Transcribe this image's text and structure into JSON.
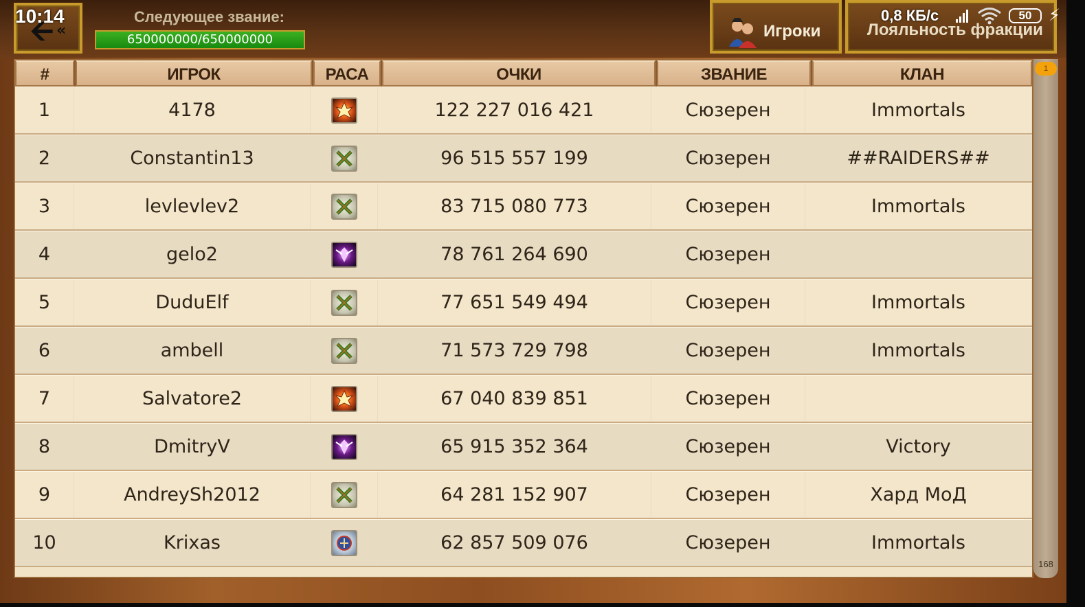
{
  "status_bar": {
    "time": "10:14",
    "network_speed": "0,8 КБ/с",
    "battery": "50"
  },
  "header": {
    "back_icon": "back-arrow-icon",
    "next_rank_label": "Следующее звание:",
    "progress_text": "650000000/650000000",
    "progress_fraction": 1.0,
    "tabs": [
      {
        "label": "Игроки",
        "icon": "players-icon"
      },
      {
        "label": "Лояльность фракции"
      }
    ]
  },
  "table": {
    "columns": [
      "#",
      "ИГРОК",
      "РАСА",
      "ОЧКИ",
      "ЗВАНИЕ",
      "КЛАН"
    ],
    "rows": [
      {
        "rank": "1",
        "player": "4178",
        "race": "fire",
        "points": "122 227 016 421",
        "title": "Сюзерен",
        "clan": "Immortals"
      },
      {
        "rank": "2",
        "player": "Constantin13",
        "race": "green",
        "points": "96 515 557 199",
        "title": "Сюзерен",
        "clan": "##RAIDERS##"
      },
      {
        "rank": "3",
        "player": "levlevlev2",
        "race": "green",
        "points": "83 715 080 773",
        "title": "Сюзерен",
        "clan": "Immortals"
      },
      {
        "rank": "4",
        "player": "gelo2",
        "race": "purple",
        "points": "78 761 264 690",
        "title": "Сюзерен",
        "clan": ""
      },
      {
        "rank": "5",
        "player": "DuduElf",
        "race": "green",
        "points": "77 651 549 494",
        "title": "Сюзерен",
        "clan": "Immortals"
      },
      {
        "rank": "6",
        "player": "ambell",
        "race": "green",
        "points": "71 573 729 798",
        "title": "Сюзерен",
        "clan": "Immortals"
      },
      {
        "rank": "7",
        "player": "Salvatore2",
        "race": "fire",
        "points": "67 040 839 851",
        "title": "Сюзерен",
        "clan": ""
      },
      {
        "rank": "8",
        "player": "DmitryV",
        "race": "purple",
        "points": "65 915 352 364",
        "title": "Сюзерен",
        "clan": "Victory"
      },
      {
        "rank": "9",
        "player": "AndreySh2012",
        "race": "green",
        "points": "64 281 152 907",
        "title": "Сюзерен",
        "clan": "Хард МоД"
      },
      {
        "rank": "10",
        "player": "Krixas",
        "race": "blue",
        "points": "62 857 509 076",
        "title": "Сюзерен",
        "clan": "Immortals"
      }
    ]
  },
  "scrollbar": {
    "top_badge": "1",
    "total_count": "168"
  },
  "colors": {
    "header_cell": "#ddb88f",
    "row_light": "#f3e6cb",
    "row_dark": "#e7dbc2",
    "frame_gold": "#c99a2c",
    "progress_green": "#2a9e18"
  }
}
